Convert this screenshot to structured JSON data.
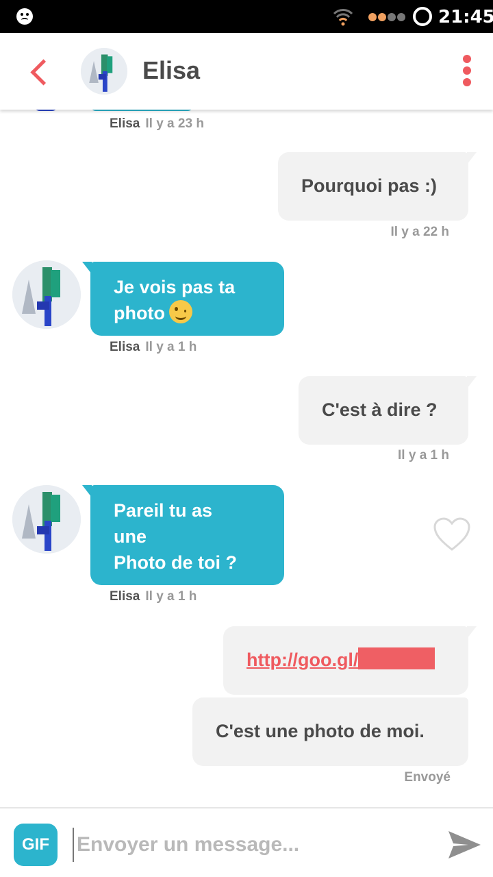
{
  "status_bar": {
    "time": "21:45",
    "face_icon": "face-icon",
    "wifi_icon": "wifi-icon",
    "signal_icon": "signal-dots-icon",
    "ring_icon": "ring-icon",
    "wifi_color": "#f0a060",
    "signal_colors": [
      "#f0a060",
      "#f0a060",
      "#777777",
      "#777777"
    ]
  },
  "header": {
    "back_icon": "chevron-left-icon",
    "contact_name": "Elisa",
    "menu_icon": "more-vertical-icon",
    "accent": "#ef5a5f"
  },
  "messages": [
    {
      "direction": "in",
      "text": "",
      "sender": "Elisa",
      "time": "Il y a 23 h"
    },
    {
      "direction": "out",
      "text": "Pourquoi pas :)",
      "time": "Il y a 22 h"
    },
    {
      "direction": "in",
      "text_line1": "Je  vois pas ta",
      "text_line2": "photo",
      "emoji": "wink-emoji-icon",
      "sender": "Elisa",
      "time": "Il y a 1 h"
    },
    {
      "direction": "out",
      "text": "C'est à dire ?",
      "time": "Il y a 1 h"
    },
    {
      "direction": "in",
      "text_line1": "Pareil tu as",
      "text_line2": "une",
      "text_line3": "Photo de toi ?",
      "sender": "Elisa",
      "time": "Il y a 1 h",
      "like_icon": "heart-outline-icon"
    },
    {
      "direction": "out",
      "link_text": "http://goo.gl/"
    },
    {
      "direction": "out",
      "text": "C'est une photo de moi.",
      "status": "Envoyé"
    }
  ],
  "composer": {
    "gif_label": "GIF",
    "placeholder": "Envoyer un message...",
    "value": "",
    "send_icon": "send-icon"
  },
  "colors": {
    "incoming_bubble": "#2cb4cd",
    "outgoing_bubble": "#f2f2f2",
    "link": "#ef5a5f"
  }
}
